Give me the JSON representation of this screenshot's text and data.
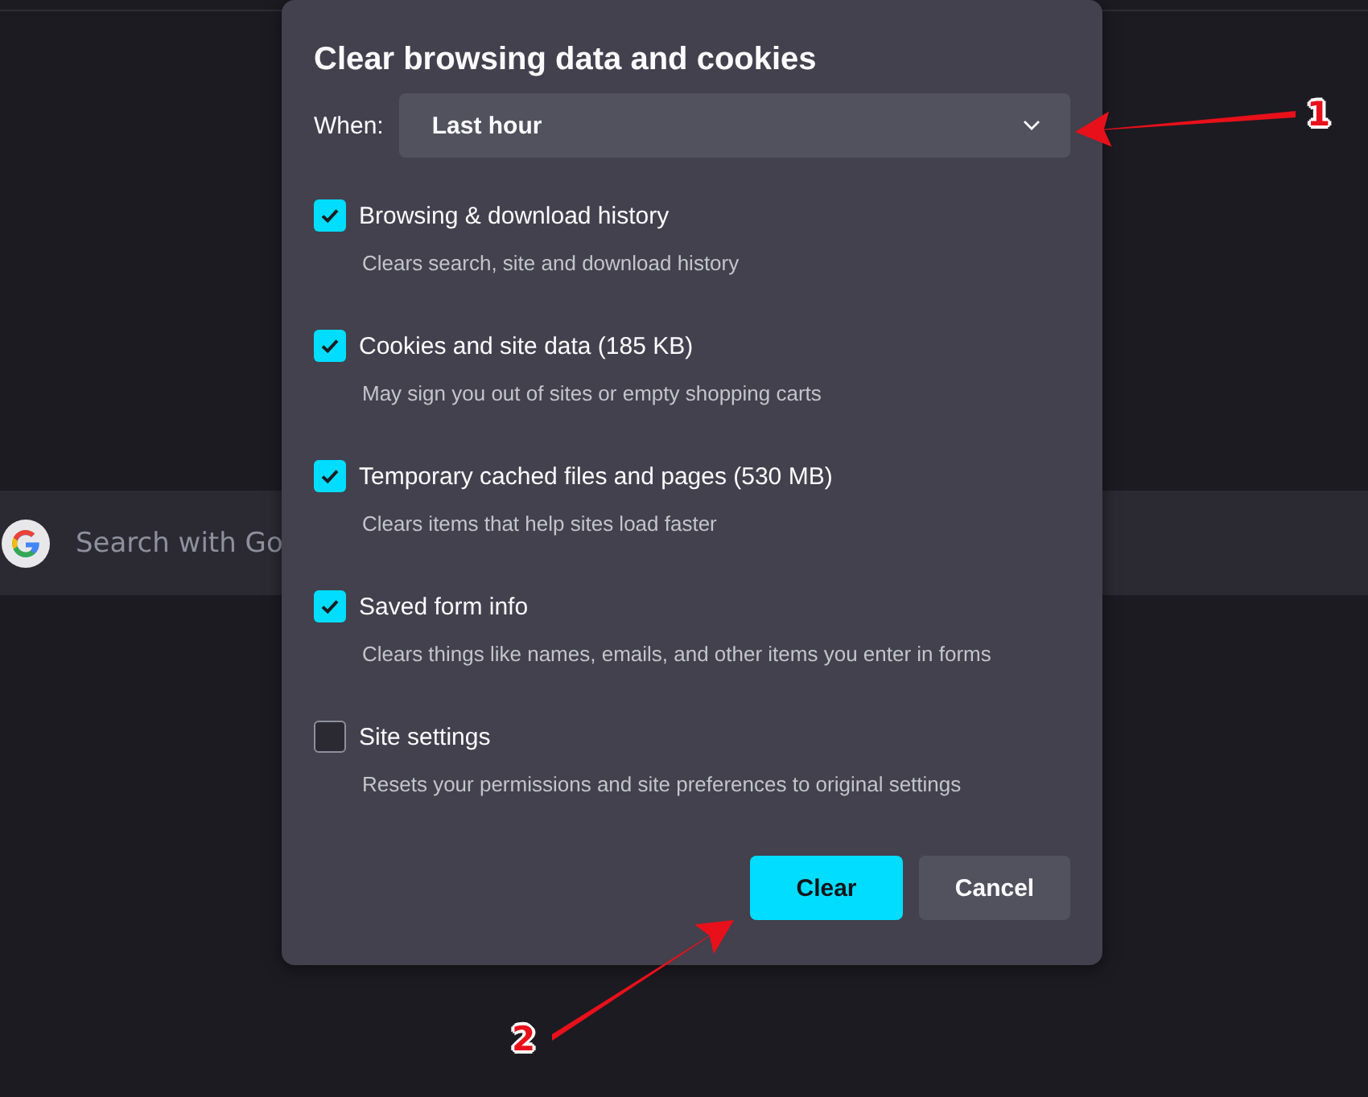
{
  "page": {
    "search": {
      "placeholder": "Search with Go"
    }
  },
  "dialog": {
    "title": "Clear browsing data and cookies",
    "when": {
      "label": "When:",
      "value": "Last hour"
    },
    "options": [
      {
        "label": "Browsing & download history",
        "description": "Clears search, site and download history",
        "checked": true
      },
      {
        "label": "Cookies and site data (185 KB)",
        "description": "May sign you out of sites or empty shopping carts",
        "checked": true
      },
      {
        "label": "Temporary cached files and pages (530 MB)",
        "description": "Clears items that help sites load faster",
        "checked": true
      },
      {
        "label": "Saved form info",
        "description": "Clears things like names, emails, and other items you enter in forms",
        "checked": true
      },
      {
        "label": "Site settings",
        "description": "Resets your permissions and site preferences to original settings",
        "checked": false
      }
    ],
    "buttons": [
      {
        "label": "Clear",
        "kind": "primary"
      },
      {
        "label": "Cancel",
        "kind": "secondary"
      }
    ]
  },
  "annotations": [
    {
      "label": "1"
    },
    {
      "label": "2"
    }
  ]
}
